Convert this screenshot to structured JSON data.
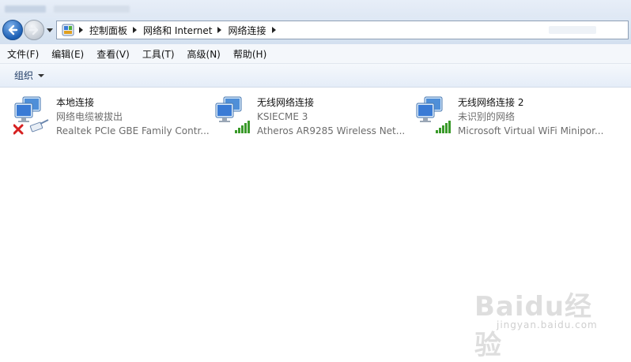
{
  "address": {
    "breadcrumbs": [
      "控制面板",
      "网络和 Internet",
      "网络连接"
    ]
  },
  "menu": [
    "文件(F)",
    "编辑(E)",
    "查看(V)",
    "工具(T)",
    "高级(N)",
    "帮助(H)"
  ],
  "command_bar": {
    "organize": "组织"
  },
  "connections": [
    {
      "name": "本地连接",
      "status": "网络电缆被拔出",
      "device": "Realtek PCIe GBE Family Contr...",
      "icon": "wired-disconnected-icon"
    },
    {
      "name": "无线网络连接",
      "status": "KSIECME  3",
      "device": "Atheros AR9285 Wireless Net...",
      "icon": "wireless-signal-icon"
    },
    {
      "name": "无线网络连接 2",
      "status": "未识别的网络",
      "device": "Microsoft Virtual WiFi Minipor...",
      "icon": "wireless-signal-icon"
    }
  ],
  "watermark": {
    "logo": "Baidu经验",
    "sub": "jingyan.baidu.com"
  },
  "colors": {
    "accent": "#1c5fb4",
    "signal": "#3a9a2a",
    "error": "#d62020"
  }
}
